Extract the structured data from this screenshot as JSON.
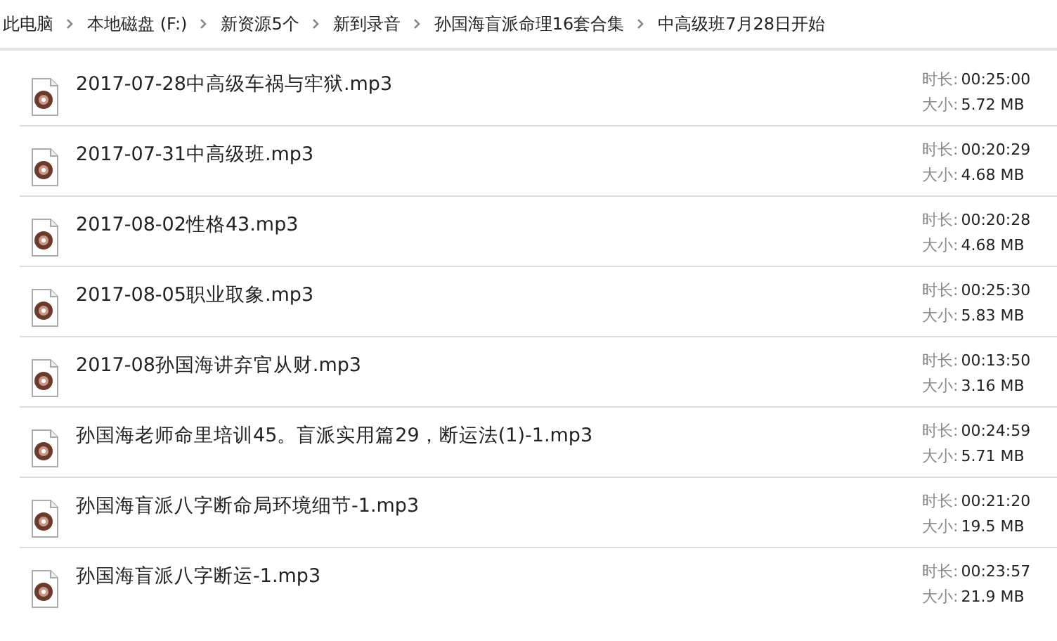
{
  "breadcrumb": [
    "此电脑",
    "本地磁盘 (F:)",
    "新资源5个",
    "新到录音",
    "孙国海盲派命理16套合集",
    "中高级班7月28日开始"
  ],
  "files": [
    {
      "name": "2017-07-28中高级车祸与牢狱.mp3",
      "duration_label": "时长:",
      "duration": "00:25:00",
      "size_label": "大小:",
      "size": "5.72 MB"
    },
    {
      "name": "2017-07-31中高级班.mp3",
      "duration_label": "时长:",
      "duration": "00:20:29",
      "size_label": "大小:",
      "size": "4.68 MB"
    },
    {
      "name": "2017-08-02性格43.mp3",
      "duration_label": "时长:",
      "duration": "00:20:28",
      "size_label": "大小:",
      "size": "4.68 MB"
    },
    {
      "name": "2017-08-05职业取象.mp3",
      "duration_label": "时长:",
      "duration": "00:25:30",
      "size_label": "大小:",
      "size": "5.83 MB"
    },
    {
      "name": "2017-08孙国海讲弃官从财.mp3",
      "duration_label": "时长:",
      "duration": "00:13:50",
      "size_label": "大小:",
      "size": "3.16 MB"
    },
    {
      "name": "孙国海老师命里培训45。盲派实用篇29，断运法(1)-1.mp3",
      "duration_label": "时长:",
      "duration": "00:24:59",
      "size_label": "大小:",
      "size": "5.71 MB"
    },
    {
      "name": "孙国海盲派八字断命局环境细节-1.mp3",
      "duration_label": "时长:",
      "duration": "00:21:20",
      "size_label": "大小:",
      "size": "19.5 MB"
    },
    {
      "name": "孙国海盲派八字断运-1.mp3",
      "duration_label": "时长:",
      "duration": "00:23:57",
      "size_label": "大小:",
      "size": "21.9 MB"
    }
  ]
}
